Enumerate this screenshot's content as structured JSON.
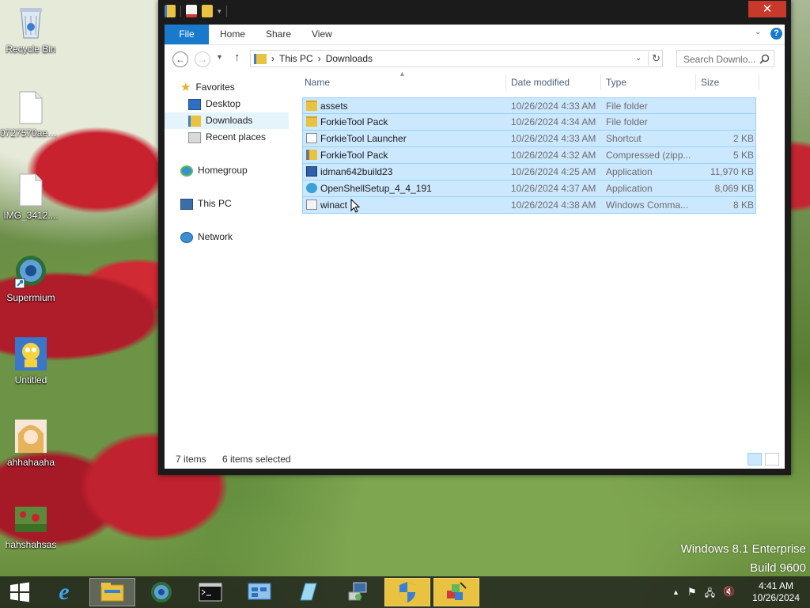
{
  "desktop": {
    "icons": [
      {
        "label": "Recycle Bin"
      },
      {
        "label": "0727570ae4f..."
      },
      {
        "label": "IMG_3412...."
      },
      {
        "label": "Supermium"
      },
      {
        "label": "Untitled"
      },
      {
        "label": "ahhahaaha"
      },
      {
        "label": "hahshahsas"
      }
    ],
    "watermark": {
      "line1": "Windows 8.1 Enterprise",
      "line2": "Build 9600"
    }
  },
  "window": {
    "close_glyph": "✕",
    "ribbon_tabs": [
      "File",
      "Home",
      "Share",
      "View"
    ],
    "help_glyph": "?",
    "address": {
      "crumbs": [
        "This PC",
        "Downloads"
      ],
      "separator": "›"
    },
    "search": {
      "placeholder": "Search Downlo..."
    },
    "nav_pane": {
      "favorites": "Favorites",
      "favorites_items": [
        "Desktop",
        "Downloads",
        "Recent places"
      ],
      "homegroup": "Homegroup",
      "this_pc": "This PC",
      "network": "Network",
      "selected": "Downloads"
    },
    "columns": {
      "name": "Name",
      "date": "Date modified",
      "type": "Type",
      "size": "Size"
    },
    "files": [
      {
        "name": "assets",
        "date": "10/26/2024 4:33 AM",
        "type": "File folder",
        "size": "",
        "icon": "folder-icon"
      },
      {
        "name": "ForkieTool Pack",
        "date": "10/26/2024 4:34 AM",
        "type": "File folder",
        "size": "",
        "icon": "folder-icon"
      },
      {
        "name": "ForkieTool Launcher",
        "date": "10/26/2024 4:33 AM",
        "type": "Shortcut",
        "size": "2 KB",
        "icon": "shortcut-icon"
      },
      {
        "name": "ForkieTool Pack",
        "date": "10/26/2024 4:32 AM",
        "type": "Compressed (zipp...",
        "size": "5 KB",
        "icon": "zip-folder-icon"
      },
      {
        "name": "idman642build23",
        "date": "10/26/2024 4:25 AM",
        "type": "Application",
        "size": "11,970 KB",
        "icon": "application-icon"
      },
      {
        "name": "OpenShellSetup_4_4_191",
        "date": "10/26/2024 4:37 AM",
        "type": "Application",
        "size": "8,069 KB",
        "icon": "globe-icon"
      },
      {
        "name": "winact",
        "date": "10/26/2024 4:38 AM",
        "type": "Windows Comma...",
        "size": "8 KB",
        "icon": "command-script-icon"
      }
    ],
    "status": {
      "items": "7 items",
      "selected": "6 items selected"
    }
  },
  "taskbar": {
    "clock_time": "4:41 AM",
    "clock_date": "10/26/2024"
  },
  "colors": {
    "accent": "#1979ca",
    "selection": "#cce8ff",
    "selection_border": "#99d1ff",
    "close": "#c7392b"
  }
}
